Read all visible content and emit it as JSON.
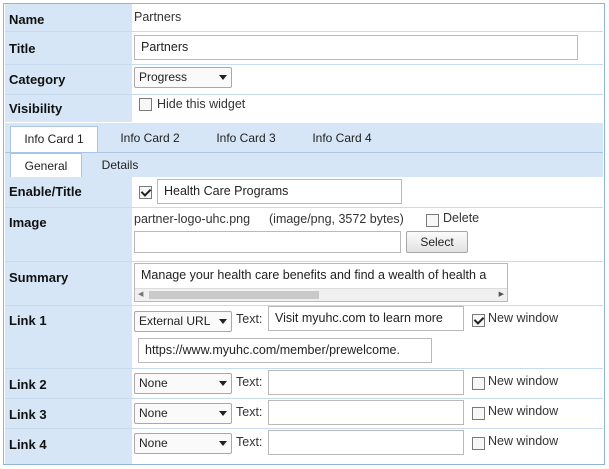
{
  "rows": {
    "name_label": "Name",
    "name_value": "Partners",
    "title_label": "Title",
    "title_value": "Partners",
    "category_label": "Category",
    "category_value": "Progress",
    "visibility_label": "Visibility",
    "hide_widget_label": "Hide this widget"
  },
  "tabs": [
    "Info Card 1",
    "Info Card 2",
    "Info Card 3",
    "Info Card 4"
  ],
  "subtabs": [
    "General",
    "Details"
  ],
  "card": {
    "enable_label": "Enable/Title",
    "enable_checked": true,
    "title_value": "Health Care Programs",
    "image_label": "Image",
    "image_file": "partner-logo-uhc.png",
    "image_meta": "(image/png, 3572 bytes)",
    "delete_label": "Delete",
    "select_button": "Select",
    "summary_label": "Summary",
    "summary_value": "Manage your health care benefits and find a wealth of health a",
    "link_text_label": "Text:",
    "new_window_label": "New window",
    "links": [
      {
        "label": "Link 1",
        "type": "External URL",
        "text": "Visit myuhc.com to learn more",
        "url": "https://www.myuhc.com/member/prewelcome.",
        "new_window": true
      },
      {
        "label": "Link 2",
        "type": "None",
        "text": "",
        "new_window": false
      },
      {
        "label": "Link 3",
        "type": "None",
        "text": "",
        "new_window": false
      },
      {
        "label": "Link 4",
        "type": "None",
        "text": "",
        "new_window": false
      }
    ]
  },
  "icons": {
    "scroll_left": "◀",
    "scroll_right": "▶"
  }
}
